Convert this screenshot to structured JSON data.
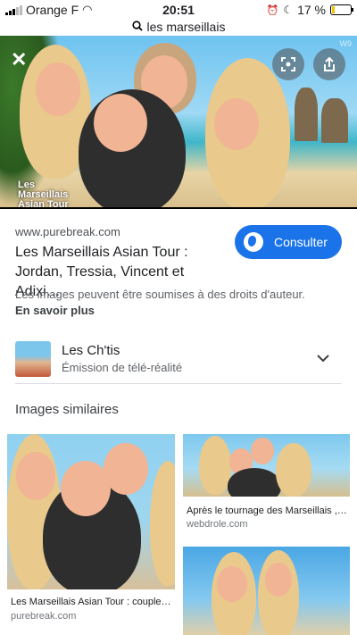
{
  "status_bar": {
    "carrier": "Orange F",
    "time": "20:51",
    "battery": "17 %",
    "battery_level": 0.17
  },
  "search": {
    "query": "les marseillais"
  },
  "hero": {
    "show_name_line1": "Les",
    "show_name_line2": "Marseillais",
    "show_name_line3": "Asian Tour",
    "watermark": "W9"
  },
  "result": {
    "domain": "www.purebreak.com",
    "title": "Les Marseillais Asian Tour : Jordan, Tressia, Vincent et Adixi…",
    "consult_label": "Consulter",
    "rights_notice": "Les images peuvent être soumises à des droits d'auteur.",
    "learn_more": "En savoir plus"
  },
  "related": {
    "name": "Les Ch'tis",
    "subtitle": "Émission de télé-réalité"
  },
  "similar": {
    "heading": "Images similaires",
    "items": [
      {
        "caption": "Les Marseillais Asian Tour : couple…",
        "site": "purebreak.com"
      },
      {
        "caption": "Après le tournage des Marseillais ,…",
        "site": "webdrole.com"
      },
      {
        "caption": "",
        "site": ""
      }
    ]
  },
  "colors": {
    "accent": "#1a73e8",
    "battery_fill": "#f2c400"
  }
}
